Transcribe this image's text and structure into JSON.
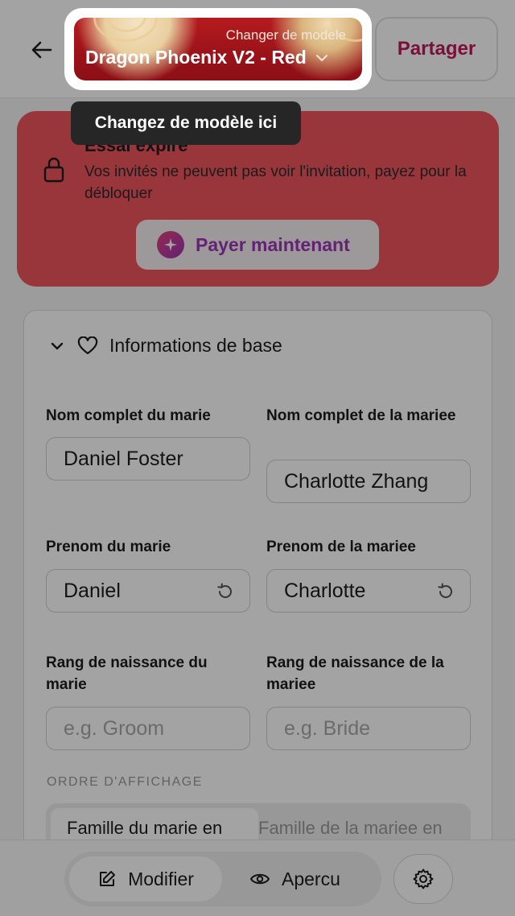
{
  "header": {
    "template_hint": "Changer de modele",
    "template_name": "Dragon Phoenix V2 - Red",
    "share_label": "Partager"
  },
  "trial": {
    "title": "Essai expire",
    "message": "Vos invités ne peuvent pas voir l'invitation, payez pour la débloquer",
    "pay_label": "Payer maintenant"
  },
  "form": {
    "section_title": "Informations de base",
    "groom_full_label": "Nom complet du marie",
    "groom_full_value": "Daniel Foster",
    "bride_full_label": "Nom complet de la mariee",
    "bride_full_value": "Charlotte Zhang",
    "groom_first_label": "Prenom du marie",
    "groom_first_value": "Daniel",
    "bride_first_label": "Prenom de la mariee",
    "bride_first_value": "Charlotte",
    "groom_rank_label": "Rang de naissance du marie",
    "groom_rank_placeholder": "e.g. Groom",
    "bride_rank_label": "Rang de naissance de la mariee",
    "bride_rank_placeholder": "e.g. Bride",
    "order_label": "ORDRE D'AFFICHAGE",
    "order_option_groom": "Famille du marie en",
    "order_option_bride": "Famille de la mariee en"
  },
  "bottom": {
    "edit_label": "Modifier",
    "preview_label": "Apercu"
  },
  "tooltip": {
    "text": "Changez de modèle ici"
  },
  "colors": {
    "accent": "#c2185b",
    "trial_bg": "#f0555e",
    "pay_text": "#9b36b7",
    "template_red": "#9a1219"
  },
  "icons": [
    "back-arrow-icon",
    "chevron-down-icon",
    "lock-icon",
    "sparkle-icon",
    "heart-icon",
    "reset-icon",
    "edit-icon",
    "eye-icon",
    "gear-icon"
  ]
}
